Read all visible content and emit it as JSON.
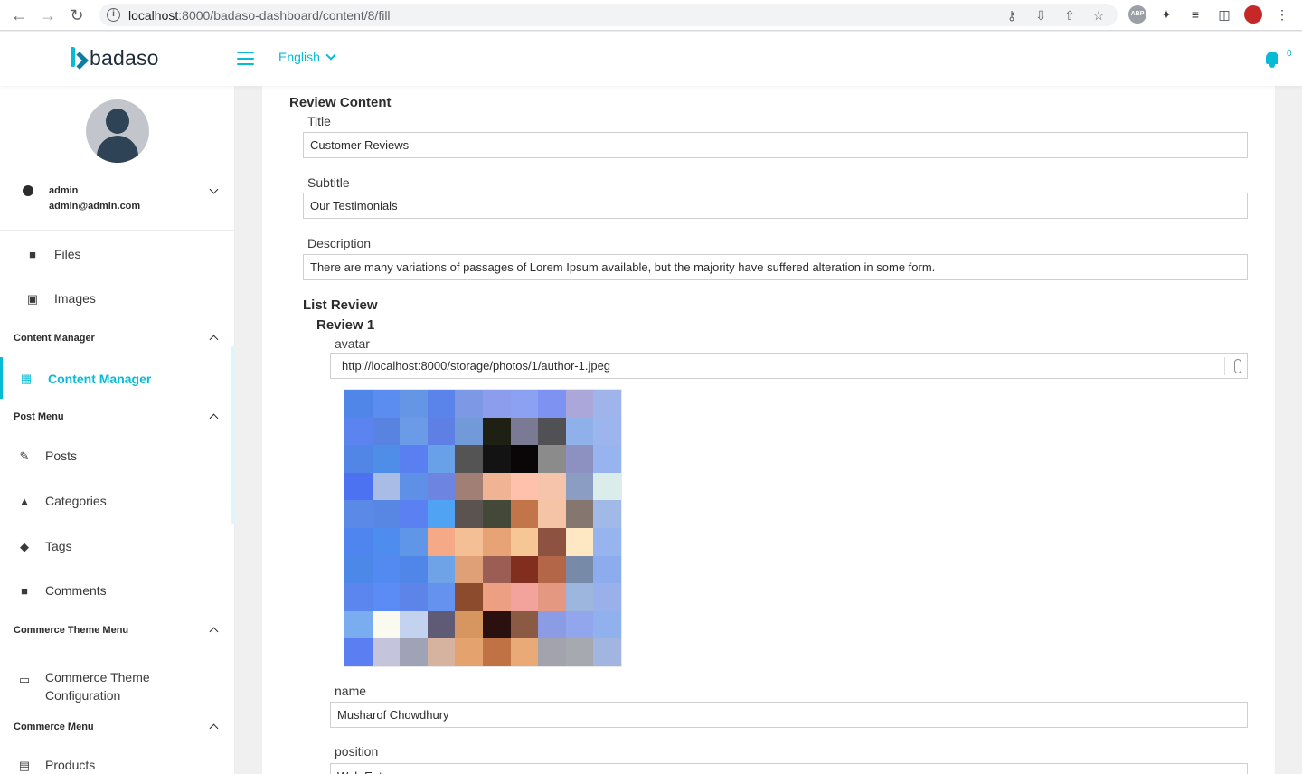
{
  "browser": {
    "url_host": "localhost",
    "url_path": ":8000/badaso-dashboard/content/8/fill"
  },
  "header": {
    "logo_text": "badaso",
    "language": "English",
    "notification_count": "0"
  },
  "sidebar": {
    "user_name": "admin",
    "user_email": "admin@admin.com",
    "files_label": "Files",
    "images_label": "Images",
    "content_manager_section": "Content Manager",
    "content_manager_item": "Content Manager",
    "post_menu_section": "Post Menu",
    "posts_label": "Posts",
    "categories_label": "Categories",
    "tags_label": "Tags",
    "comments_label": "Comments",
    "commerce_theme_section": "Commerce Theme Menu",
    "commerce_theme_config_line1": "Commerce Theme",
    "commerce_theme_config_line2": "Configuration",
    "commerce_menu_section": "Commerce Menu",
    "products_label": "Products"
  },
  "form": {
    "section_title": "Review Content",
    "title_label": "Title",
    "title_value": "Customer Reviews",
    "subtitle_label": "Subtitle",
    "subtitle_value": "Our Testimonials",
    "description_label": "Description",
    "description_value": "There are many variations of passages of Lorem Ipsum available, but the majority have suffered alteration in some form.",
    "list_title": "List Review",
    "review_title": "Review 1",
    "avatar_label": "avatar",
    "avatar_value": "http://localhost:8000/storage/photos/1/author-1.jpeg",
    "name_label": "name",
    "name_value": "Musharof Chowdhury",
    "position_label": "position",
    "position_value": "Web Entrepreneur"
  },
  "colors": {
    "accent": "#06bbd3",
    "text": "#2c2c2c"
  },
  "avatar_preview_pixels": [
    "#4f86e8",
    "#5b8cef",
    "#6596e6",
    "#5b84ea",
    "#7d98e4",
    "#8c9ded",
    "#8ba1f1",
    "#7e92f2",
    "#aba7d9",
    "#a0b4ec",
    "#5b84f0",
    "#5883e0",
    "#6b9ae6",
    "#5e7fe3",
    "#7299d8",
    "#1d2012",
    "#7b7a94",
    "#515054",
    "#8fb0e8",
    "#9cb5ee",
    "#5186e6",
    "#4e8ee9",
    "#5a7ff0",
    "#69a1e8",
    "#545454",
    "#131313",
    "#0a0506",
    "#8b8b8b",
    "#8d91c2",
    "#98b4ee",
    "#4c72f1",
    "#a8bce6",
    "#5f90e8",
    "#6d85e0",
    "#a27f75",
    "#f0b394",
    "#ffc1ab",
    "#f6c4ab",
    "#8c9dc3",
    "#dbedeb",
    "#5b89e8",
    "#5787e2",
    "#5a80f1",
    "#50a2f3",
    "#5b5350",
    "#444838",
    "#c17548",
    "#f5c3a5",
    "#857670",
    "#a0b9e6",
    "#4e85ee",
    "#4f8cf0",
    "#6096e7",
    "#f6a986",
    "#f4bf94",
    "#e7a275",
    "#f6c795",
    "#8e5340",
    "#fee8c4",
    "#97b4ee",
    "#4c88e8",
    "#528af2",
    "#4f86e8",
    "#6ea3e8",
    "#df9f77",
    "#9c5e54",
    "#812e1f",
    "#b46648",
    "#778ba8",
    "#8cacee",
    "#5a86ee",
    "#5b8cf5",
    "#5d85e9",
    "#6592ef",
    "#8d4b2e",
    "#ed9f84",
    "#f4a39c",
    "#e59881",
    "#9db6de",
    "#9ab0ea",
    "#7aacf0",
    "#fbfaf0",
    "#c3d2ef",
    "#5f5b77",
    "#d79560",
    "#2a100e",
    "#8a5a44",
    "#8b9ce4",
    "#91a6ec",
    "#90b1ee",
    "#5b7ff3",
    "#c4c5dc",
    "#9fa3b6",
    "#d6b39f",
    "#e4a36e",
    "#c07245",
    "#eaaa78",
    "#a2a3ad",
    "#a7a9b0",
    "#a2b5e0"
  ]
}
